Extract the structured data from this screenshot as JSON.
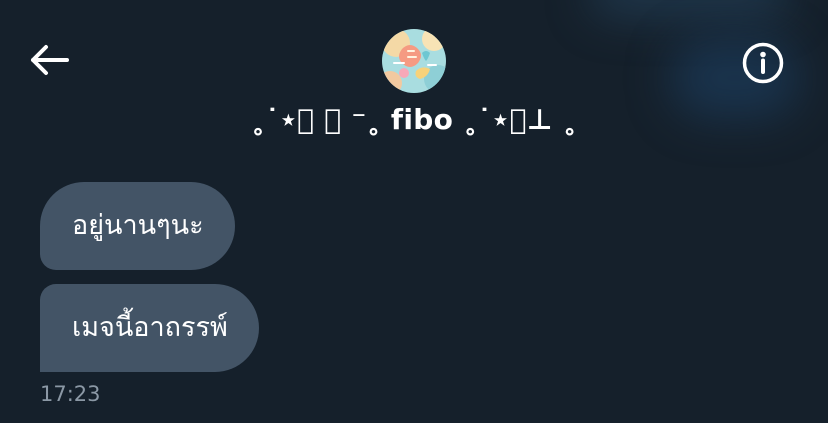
{
  "header": {
    "back_icon": "arrow-left-icon",
    "info_icon": "info-circle-icon",
    "avatar_icon": "profile-avatar",
    "conversation_name": "˳˙⋆⃞ ⸝ ⁻˳ fibo ˳˙⋆⍝⊥ ˳"
  },
  "messages": [
    {
      "text": "อยู่นานๆนะ"
    },
    {
      "text": "เมจนี้อาถรรพ์"
    }
  ],
  "timestamp": "17:23",
  "colors": {
    "background": "#15202b",
    "bubble": "#435466",
    "text": "#ffffff",
    "timestamp": "#8b98a5"
  }
}
